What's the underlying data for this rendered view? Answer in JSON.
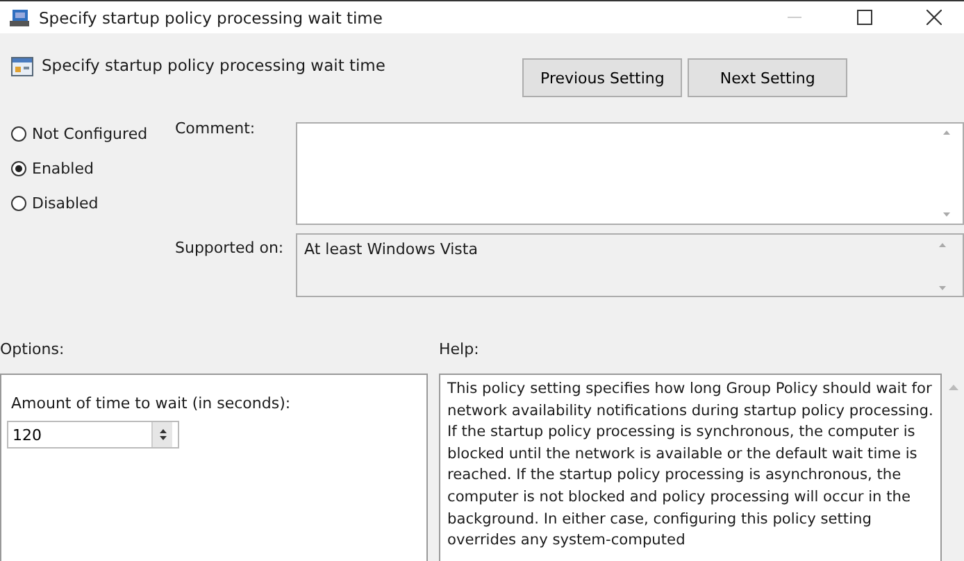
{
  "window": {
    "title": "Specify startup policy processing wait time"
  },
  "header": {
    "title": "Specify startup policy processing wait time",
    "buttons": [
      "Previous Setting",
      "Next Setting"
    ]
  },
  "state_options": [
    {
      "label": "Not Configured",
      "selected": false
    },
    {
      "label": "Enabled",
      "selected": true
    },
    {
      "label": "Disabled",
      "selected": false
    }
  ],
  "comment": {
    "label": "Comment:"
  },
  "supported_on": {
    "label": "Supported on:",
    "value": "At least Windows Vista"
  },
  "options": {
    "label": "Options:",
    "field_label": "Amount of time to wait (in seconds):",
    "value": "120"
  },
  "help": {
    "label": "Help:",
    "text": "This policy setting specifies how long Group Policy should wait for network availability notifications during startup policy processing. If the startup policy processing is synchronous, the computer is blocked until the network is available or the default wait time is reached. If the startup policy processing is asynchronous, the computer is not blocked and policy processing will occur in the background. In either case, configuring this policy setting overrides any system-computed"
  }
}
